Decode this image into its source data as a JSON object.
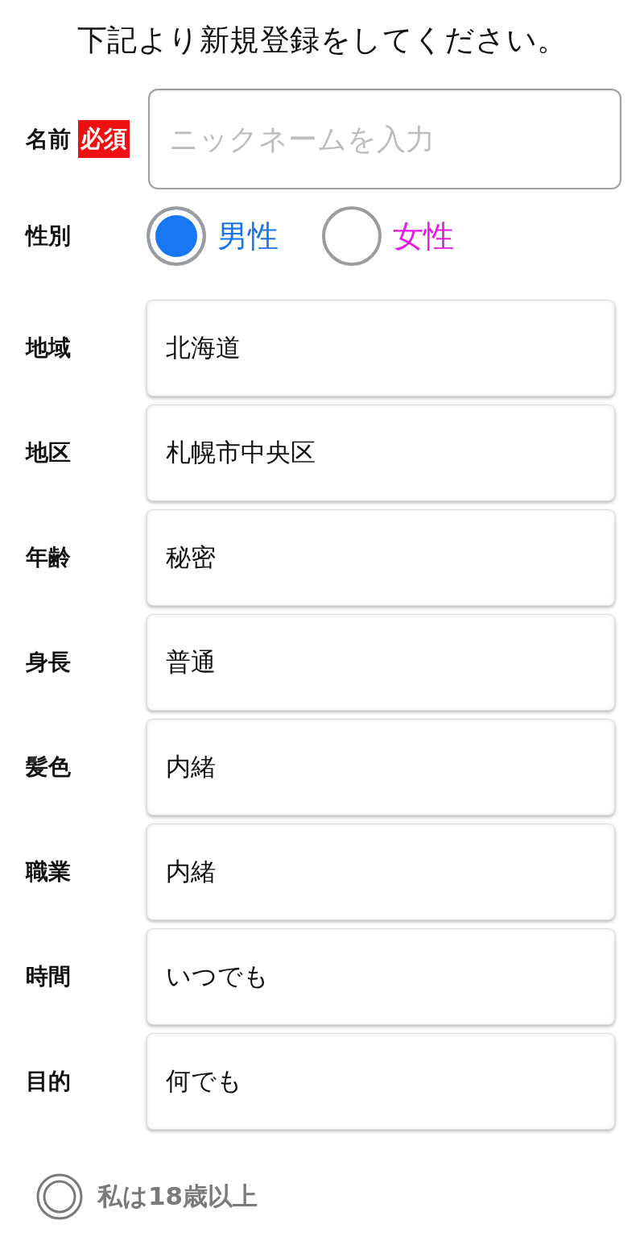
{
  "heading": "下記より新規登録をしてください。",
  "name_field": {
    "label": "名前",
    "required_badge": "必須",
    "placeholder": "ニックネームを入力"
  },
  "gender": {
    "label": "性別",
    "options": [
      {
        "label": "男性",
        "selected": true,
        "color": "#1a73e8"
      },
      {
        "label": "女性",
        "selected": false,
        "color": "#e619e6"
      }
    ]
  },
  "fields": [
    {
      "label": "地域",
      "value": "北海道"
    },
    {
      "label": "地区",
      "value": "札幌市中央区"
    },
    {
      "label": "年齢",
      "value": "秘密"
    },
    {
      "label": "身長",
      "value": "普通"
    },
    {
      "label": "髪色",
      "value": "内緒"
    },
    {
      "label": "職業",
      "value": "内緒"
    },
    {
      "label": "時間",
      "value": "いつでも"
    },
    {
      "label": "目的",
      "value": "何でも"
    }
  ],
  "agreement": {
    "text": "私は18歳以上",
    "checked": false
  }
}
